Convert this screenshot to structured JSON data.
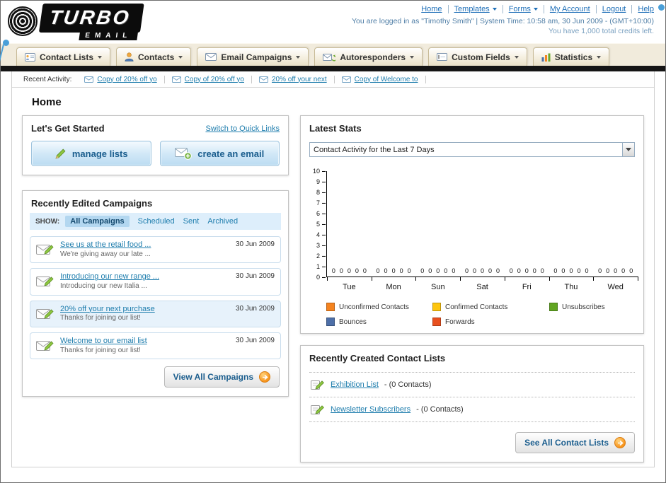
{
  "header": {
    "logo": {
      "line1": "TURBO",
      "line2": "EMAIL"
    },
    "links": [
      {
        "label": "Home",
        "dropdown": false
      },
      {
        "label": "Templates",
        "dropdown": true
      },
      {
        "label": "Forms",
        "dropdown": true
      },
      {
        "label": "My Account",
        "dropdown": false
      },
      {
        "label": "Logout",
        "dropdown": false
      },
      {
        "label": "Help",
        "dropdown": false
      }
    ],
    "login_info": "You are logged in as \"Timothy Smith\" | System Time: 10:58 am, 30 Jun 2009 - (GMT+10:00)",
    "credits_info": "You have 1,000 total credits left."
  },
  "nav": {
    "tabs": [
      {
        "label": "Contact Lists"
      },
      {
        "label": "Contacts"
      },
      {
        "label": "Email Campaigns"
      },
      {
        "label": "Autoresponders"
      },
      {
        "label": "Custom Fields"
      },
      {
        "label": "Statistics"
      }
    ]
  },
  "recent_activity": {
    "label": "Recent Activity:",
    "items": [
      "Copy of 20% off yo",
      "Copy of 20% off yo",
      "20% off your next",
      "Copy of Welcome to"
    ]
  },
  "page": {
    "title": "Home"
  },
  "get_started": {
    "title": "Let's Get Started",
    "switch_link": "Switch to Quick Links",
    "manage_lists_label": "manage lists",
    "create_email_label": "create an email"
  },
  "campaigns": {
    "title": "Recently Edited Campaigns",
    "show_label": "SHOW:",
    "filters": [
      {
        "label": "All Campaigns",
        "selected": true
      },
      {
        "label": "Scheduled",
        "selected": false
      },
      {
        "label": "Sent",
        "selected": false
      },
      {
        "label": "Archived",
        "selected": false
      }
    ],
    "items": [
      {
        "title": "See us at the retail food ...",
        "subtitle": "We're giving away our late ...",
        "date": "30 Jun 2009",
        "bg": "#ffffff"
      },
      {
        "title": "Introducing our new range ...",
        "subtitle": "Introducing our new Italia ...",
        "date": "30 Jun 2009",
        "bg": "#ffffff"
      },
      {
        "title": "20% off your next purchase",
        "subtitle": "Thanks for joining our list!",
        "date": "30 Jun 2009",
        "bg": "#e7f2fb"
      },
      {
        "title": "Welcome to our email list",
        "subtitle": "Thanks for joining our list!",
        "date": "30 Jun 2009",
        "bg": "#ffffff"
      }
    ],
    "view_all_label": "View All Campaigns"
  },
  "stats": {
    "title": "Latest Stats",
    "dropdown_value": "Contact Activity for the Last 7 Days",
    "chart_data": {
      "type": "bar",
      "title": "Contact Activity for the Last 7 Days",
      "categories": [
        "Tue",
        "Mon",
        "Sun",
        "Sat",
        "Fri",
        "Thu",
        "Wed"
      ],
      "series": [
        {
          "name": "Unconfirmed Contacts",
          "color": "#f5831f",
          "values": [
            0,
            0,
            0,
            0,
            0,
            0,
            0
          ]
        },
        {
          "name": "Confirmed Contacts",
          "color": "#fdc50f",
          "values": [
            0,
            0,
            0,
            0,
            0,
            0,
            0
          ]
        },
        {
          "name": "Unsubscribes",
          "color": "#61a521",
          "values": [
            0,
            0,
            0,
            0,
            0,
            0,
            0
          ]
        },
        {
          "name": "Bounces",
          "color": "#4d6fa8",
          "values": [
            0,
            0,
            0,
            0,
            0,
            0,
            0
          ]
        },
        {
          "name": "Forwards",
          "color": "#e8501f",
          "values": [
            0,
            0,
            0,
            0,
            0,
            0,
            0
          ]
        }
      ],
      "ylim": [
        0,
        10
      ],
      "y_step": 1,
      "grid": false,
      "legend_position": "bottom"
    }
  },
  "contact_lists": {
    "title": "Recently Created Contact Lists",
    "items": [
      {
        "name": "Exhibition List",
        "suffix": "- (0 Contacts)"
      },
      {
        "name": "Newsletter Subscribers",
        "suffix": "- (0 Contacts)"
      }
    ],
    "see_all_label": "See All Contact Lists"
  }
}
